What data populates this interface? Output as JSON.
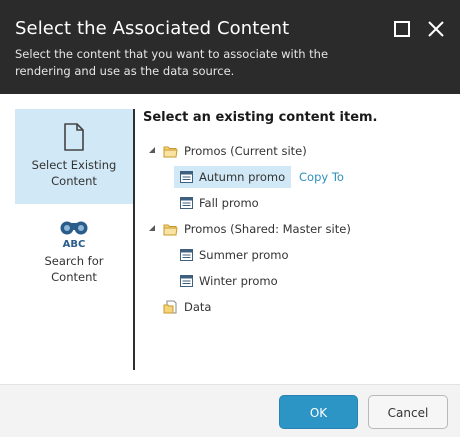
{
  "dialog": {
    "title": "Select the Associated Content",
    "subtitle": "Select the content that you want to associate with the rendering and use as the data source.",
    "maximize_icon": "maximize-icon",
    "close_icon": "close-icon"
  },
  "sidebar": {
    "items": [
      {
        "label": "Select Existing Content",
        "icon": "document-icon",
        "selected": true
      },
      {
        "label": "Search for Content",
        "icon": "binoculars-abc-icon",
        "selected": false
      }
    ]
  },
  "main": {
    "heading": "Select an existing content item.",
    "copy_to_label": "Copy To",
    "tree": [
      {
        "label": "Promos (Current site)",
        "type": "folder",
        "expanded": true
      },
      {
        "label": "Autumn promo",
        "type": "item",
        "selected": true
      },
      {
        "label": "Fall promo",
        "type": "item"
      },
      {
        "label": "Promos (Shared: Master site)",
        "type": "folder",
        "expanded": true
      },
      {
        "label": "Summer promo",
        "type": "item"
      },
      {
        "label": "Winter promo",
        "type": "item"
      },
      {
        "label": "Data",
        "type": "data"
      }
    ]
  },
  "footer": {
    "ok_label": "OK",
    "cancel_label": "Cancel"
  },
  "colors": {
    "header_bg": "#2b2b2b",
    "selection_bg": "#d1e9f6",
    "link": "#2f8fbd",
    "primary_button": "#2d94c6",
    "footer_bg": "#f3f3f3"
  }
}
